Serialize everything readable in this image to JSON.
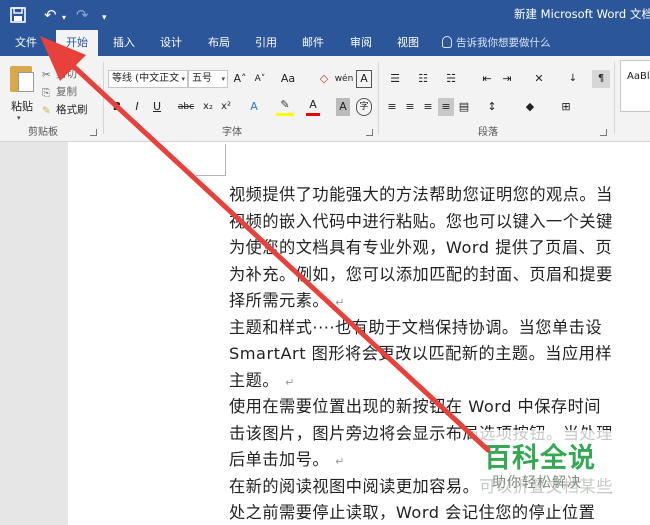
{
  "titlebar": {
    "title": "新建 Microsoft Word 文档",
    "save_icon": "save-icon",
    "undo_icon": "undo-icon",
    "redo_icon": "redo-icon"
  },
  "tabs": [
    {
      "label": "文件",
      "active": false
    },
    {
      "label": "开始",
      "active": true
    },
    {
      "label": "插入",
      "active": false
    },
    {
      "label": "设计",
      "active": false
    },
    {
      "label": "布局",
      "active": false
    },
    {
      "label": "引用",
      "active": false
    },
    {
      "label": "邮件",
      "active": false
    },
    {
      "label": "审阅",
      "active": false
    },
    {
      "label": "视图",
      "active": false
    }
  ],
  "tell_me": "告诉我你想要做什么",
  "clipboard": {
    "paste": "粘贴",
    "cut": "剪切",
    "copy": "复制",
    "format_painter": "格式刷",
    "group_label": "剪贴板"
  },
  "font": {
    "font_name": "等线 (中文正文",
    "font_size": "五号",
    "grow": "A˄",
    "shrink": "A˅",
    "change_case": "Aa",
    "phonetic": "wén",
    "border_char": "A",
    "bold": "B",
    "italic": "I",
    "underline": "U",
    "strike": "abc",
    "subscript": "x₂",
    "superscript": "x²",
    "text_effect": "A",
    "font_color": "A",
    "char_shading": "A",
    "enclose": "字",
    "group_label": "字体"
  },
  "paragraph": {
    "group_label": "段落"
  },
  "styles": {
    "preview": "AaBl"
  },
  "document": {
    "lines": [
      {
        "text": "视频提供了功能强大的方法帮助您证明您的观点。当",
        "pmark": ""
      },
      {
        "text": "视频的嵌入代码中进行粘贴。您也可以键入一个关键",
        "pmark": ""
      },
      {
        "text": "为使您的文档具有专业外观，Word 提供了页眉、页",
        "pmark": ""
      },
      {
        "text": "为补充。例如，您可以添加匹配的封面、页眉和提要",
        "pmark": ""
      },
      {
        "text": "择所需元素。",
        "pmark": "↵"
      },
      {
        "text": "主题和样式····也有助于文档保持协调。当您单击设",
        "pmark": ""
      },
      {
        "text": "SmartArt 图形将会更改以匹配新的主题。当应用样",
        "pmark": ""
      },
      {
        "text": "主题。",
        "pmark": "↵"
      },
      {
        "text": "使用在需要位置出现的新按钮在 Word 中保存时间",
        "pmark": ""
      },
      {
        "text": "击该图片，图片旁边将会显示布局选项按钮。当处理",
        "pmark": ""
      },
      {
        "text": "后单击加号。",
        "pmark": "↵"
      },
      {
        "text": "在新的阅读视图中阅读更加容易。可以折叠文档某些",
        "pmark": ""
      },
      {
        "text": "处之前需要停止读取，Word 会记住您的停止位置",
        "pmark": ""
      }
    ]
  },
  "watermark": {
    "title": "百科全说",
    "subtitle": "助你轻松解决"
  },
  "colors": {
    "ribbon_blue": "#2b579a",
    "arrow_red": "#e8403a",
    "watermark_green": "#34a853"
  }
}
